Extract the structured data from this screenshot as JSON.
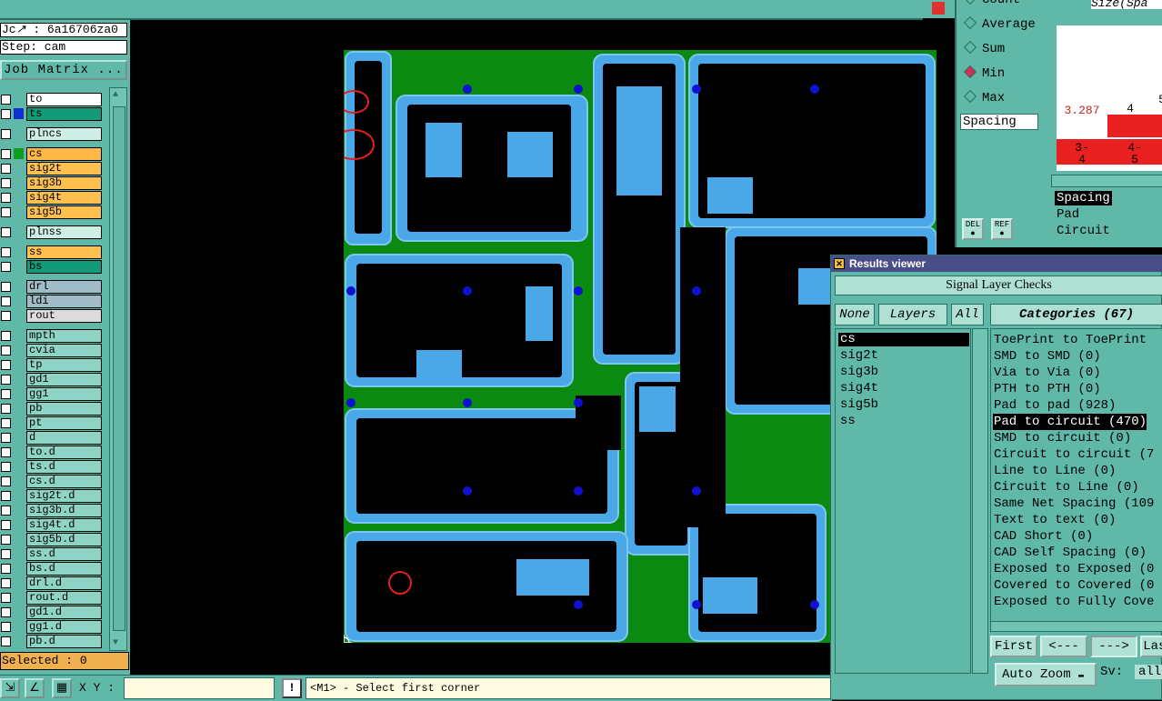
{
  "job": {
    "name": "6a16706za0",
    "step": "Step: cam",
    "matrix_button": "Job Matrix ..."
  },
  "layers": [
    {
      "name": "to",
      "color": "#ffffff",
      "swatch": "",
      "group": 0
    },
    {
      "name": "ts",
      "color": "#139a78",
      "swatch": "#1030d0",
      "group": 0
    },
    {
      "name": "plncs",
      "color": "#cfeee6",
      "swatch": "",
      "group": 1
    },
    {
      "name": "cs",
      "color": "#ffb848",
      "swatch": "#0d9e20",
      "group": 2
    },
    {
      "name": "sig2t",
      "color": "#ffc050",
      "swatch": "",
      "group": 2
    },
    {
      "name": "sig3b",
      "color": "#ffc050",
      "swatch": "",
      "group": 2
    },
    {
      "name": "sig4t",
      "color": "#ffc050",
      "swatch": "",
      "group": 2
    },
    {
      "name": "sig5b",
      "color": "#ffc050",
      "swatch": "",
      "group": 2
    },
    {
      "name": "plnss",
      "color": "#cfeee6",
      "swatch": "",
      "group": 3
    },
    {
      "name": "ss",
      "color": "#ffc050",
      "swatch": "",
      "group": 4
    },
    {
      "name": "bs",
      "color": "#139a78",
      "swatch": "",
      "group": 4
    },
    {
      "name": "drl",
      "color": "#a0bcc8",
      "swatch": "",
      "group": 5
    },
    {
      "name": "ldi",
      "color": "#a0bcc8",
      "swatch": "",
      "group": 5
    },
    {
      "name": "rout",
      "color": "#dcdcdc",
      "swatch": "",
      "group": 5
    },
    {
      "name": "mpth",
      "color": "#8ed4c6",
      "swatch": "",
      "group": 6
    },
    {
      "name": "cvia",
      "color": "#8ed4c6",
      "swatch": "",
      "group": 6
    },
    {
      "name": "tp",
      "color": "#8ed4c6",
      "swatch": "",
      "group": 6
    },
    {
      "name": "gd1",
      "color": "#8ed4c6",
      "swatch": "",
      "group": 6
    },
    {
      "name": "gg1",
      "color": "#8ed4c6",
      "swatch": "",
      "group": 6
    },
    {
      "name": "pb",
      "color": "#8ed4c6",
      "swatch": "",
      "group": 6
    },
    {
      "name": "pt",
      "color": "#8ed4c6",
      "swatch": "",
      "group": 6
    },
    {
      "name": "d",
      "color": "#8ed4c6",
      "swatch": "",
      "group": 6
    },
    {
      "name": "to.d",
      "color": "#8ed4c6",
      "swatch": "",
      "group": 6
    },
    {
      "name": "ts.d",
      "color": "#8ed4c6",
      "swatch": "",
      "group": 6
    },
    {
      "name": "cs.d",
      "color": "#8ed4c6",
      "swatch": "",
      "group": 6
    },
    {
      "name": "sig2t.d",
      "color": "#8ed4c6",
      "swatch": "",
      "group": 6
    },
    {
      "name": "sig3b.d",
      "color": "#8ed4c6",
      "swatch": "",
      "group": 6
    },
    {
      "name": "sig4t.d",
      "color": "#8ed4c6",
      "swatch": "",
      "group": 6
    },
    {
      "name": "sig5b.d",
      "color": "#8ed4c6",
      "swatch": "",
      "group": 6
    },
    {
      "name": "ss.d",
      "color": "#8ed4c6",
      "swatch": "",
      "group": 6
    },
    {
      "name": "bs.d",
      "color": "#8ed4c6",
      "swatch": "",
      "group": 6
    },
    {
      "name": "drl.d",
      "color": "#8ed4c6",
      "swatch": "",
      "group": 6
    },
    {
      "name": "rout.d",
      "color": "#8ed4c6",
      "swatch": "",
      "group": 6
    },
    {
      "name": "gd1.d",
      "color": "#8ed4c6",
      "swatch": "",
      "group": 6
    },
    {
      "name": "gg1.d",
      "color": "#8ed4c6",
      "swatch": "",
      "group": 6
    },
    {
      "name": "pb.d",
      "color": "#8ed4c6",
      "swatch": "",
      "group": 6
    }
  ],
  "selected": "Selected : 0",
  "bottom": {
    "xy_label": "X Y :",
    "xy_value": "",
    "warning": "!",
    "status": "<M1> - Select first corner"
  },
  "stats": {
    "header_text": "Size(Spa",
    "radios": [
      {
        "label": "Count",
        "on": false
      },
      {
        "label": "Average",
        "on": false
      },
      {
        "label": "Sum",
        "on": false
      },
      {
        "label": "Min",
        "on": true
      },
      {
        "label": "Max",
        "on": false
      }
    ],
    "measure": "Spacing",
    "histogram_values": [
      "3.287",
      "4",
      "5"
    ],
    "histogram_bins": [
      "3-\n4",
      "4-\n5"
    ],
    "del_label": "DEL",
    "ref_label": "REF",
    "select_items": [
      "Spacing",
      "Pad",
      "Circuit"
    ]
  },
  "results": {
    "title": "Results viewer",
    "check_title": "Signal Layer Checks",
    "none_label": "None",
    "layers_label": "Layers",
    "all_label": "All",
    "categories_label": "Categories (67)",
    "layer_items": [
      "cs",
      "sig2t",
      "sig3b",
      "sig4t",
      "sig5b",
      "ss"
    ],
    "selected_layer": 0,
    "categories": [
      "ToePrint to ToePrint",
      "SMD to SMD (0)",
      "Via to Via (0)",
      "PTH to PTH (0)",
      "Pad to pad (928)",
      "Pad to circuit (470)",
      "SMD to circuit (0)",
      "Circuit to circuit (7",
      "Line to Line (0)",
      "Circuit to Line (0)",
      "Same Net Spacing (109",
      "Text to text (0)",
      "CAD Short (0)",
      "CAD Self Spacing (0)",
      "Exposed to Exposed (0",
      "Covered to Covered (0",
      "Exposed to Fully Cove"
    ],
    "selected_category": 5,
    "nav": {
      "first": "First",
      "prev": "<---",
      "next": "--->",
      "last": "Last"
    },
    "auto_zoom": "Auto Zoom",
    "sv_label": "Sv:",
    "sv_value": "all"
  },
  "colors": {
    "panel": "#5fb8a8",
    "board_green": "#0a8a10",
    "board_blue": "#4aa8e8",
    "via": "#1010d0",
    "marker": "#e02020"
  }
}
